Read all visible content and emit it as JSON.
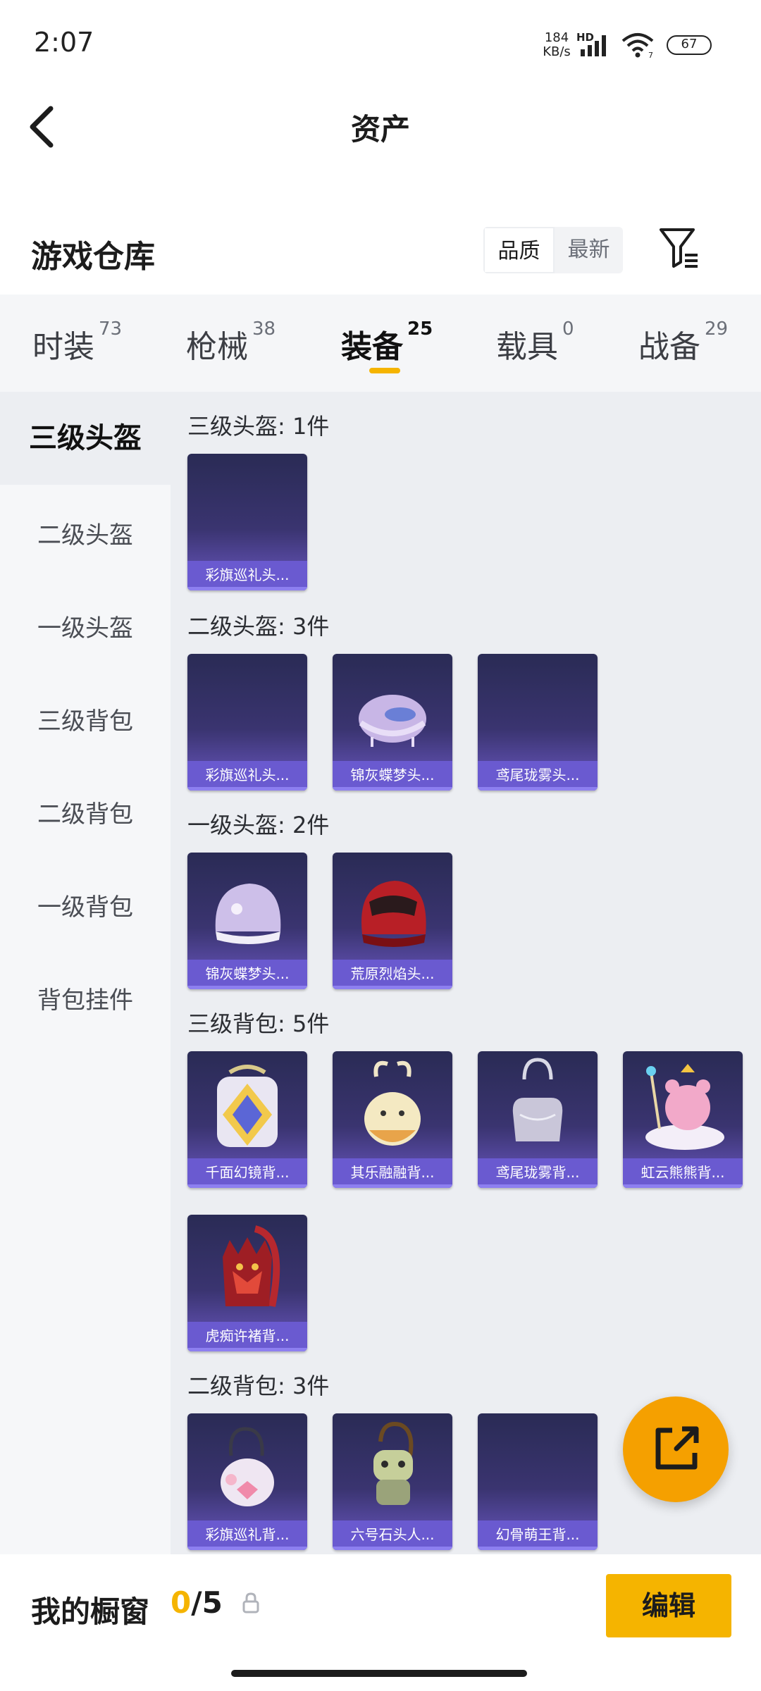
{
  "status": {
    "time": "2:07",
    "net_speed": "184",
    "net_unit": "KB/s",
    "hd": "HD",
    "wifi_num": "7",
    "battery": "67"
  },
  "header": {
    "title": "资产"
  },
  "section": {
    "title": "游戏仓库",
    "sort_options": [
      "品质",
      "最新"
    ],
    "sort_selected": "品质"
  },
  "tabs": [
    {
      "label": "时装",
      "count": "73"
    },
    {
      "label": "枪械",
      "count": "38"
    },
    {
      "label": "装备",
      "count": "25",
      "active": true
    },
    {
      "label": "载具",
      "count": "0"
    },
    {
      "label": "战备",
      "count": "29"
    }
  ],
  "sidebar": {
    "items": [
      "三级头盔",
      "二级头盔",
      "一级头盔",
      "三级背包",
      "二级背包",
      "一级背包",
      "背包挂件"
    ],
    "active": "三级头盔"
  },
  "groups": [
    {
      "title": "三级头盔: 1件",
      "items": [
        "彩旗巡礼头..."
      ]
    },
    {
      "title": "二级头盔: 3件",
      "items": [
        "彩旗巡礼头...",
        "锦灰蝶梦头...",
        "鸢尾珑雾头..."
      ]
    },
    {
      "title": "一级头盔: 2件",
      "items": [
        "锦灰蝶梦头...",
        "荒原烈焰头..."
      ]
    },
    {
      "title": "三级背包: 5件",
      "items": [
        "千面幻镜背...",
        "其乐融融背...",
        "鸢尾珑雾背...",
        "虹云熊熊背...",
        "虎痴许褚背..."
      ]
    },
    {
      "title": "二级背包: 3件",
      "items": [
        "彩旗巡礼背...",
        "六号石头人...",
        "幻骨萌王背..."
      ]
    }
  ],
  "showcase": {
    "label": "我的橱窗",
    "current": "0",
    "total": "/5",
    "edit_label": "编辑"
  },
  "colors": {
    "accent": "#f5b400",
    "card_caption": "#6a5ad0",
    "fab": "#f5a000"
  }
}
